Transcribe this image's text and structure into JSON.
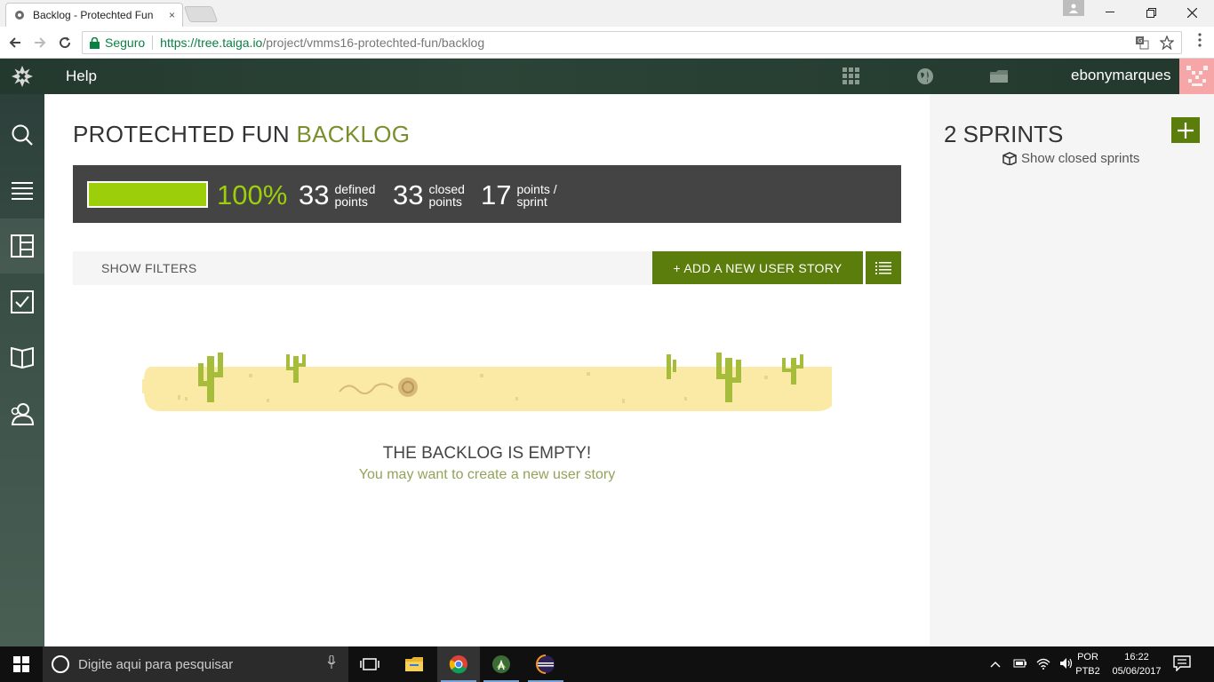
{
  "browser": {
    "tab_title": "Backlog - Protechted Fun",
    "tab_close": "×",
    "secure_label": "Seguro",
    "url_host": "https://tree.taiga.io",
    "url_path": "/project/vmms16-protechted-fun/backlog"
  },
  "topnav": {
    "help": "Help",
    "username": "ebonymarques",
    "icons": [
      "apps-grid-icon",
      "globe-icon",
      "folder-icon"
    ]
  },
  "sidebar": {
    "items": [
      "search-icon",
      "backlog-icon",
      "kanban-icon",
      "issues-icon",
      "wiki-icon",
      "team-icon"
    ]
  },
  "backlog": {
    "title_project": "PROTECHTED FUN",
    "title_section": "BACKLOG",
    "progress_percent": 100,
    "percent_label": "100%",
    "defined_points": "33",
    "defined_label_1": "defined",
    "defined_label_2": "points",
    "closed_points": "33",
    "closed_label_1": "closed",
    "closed_label_2": "points",
    "sprint_points": "17",
    "sprint_label_1": "points /",
    "sprint_label_2": "sprint",
    "show_filters": "SHOW FILTERS",
    "add_story": "+ ADD A NEW USER STORY",
    "empty_title": "THE BACKLOG IS EMPTY!",
    "empty_sub": "You may want to create a new user story"
  },
  "sprints": {
    "title": "2 SPRINTS",
    "show_closed": "Show closed sprints"
  },
  "taskbar": {
    "search_placeholder": "Digite aqui para pesquisar",
    "lang_1": "POR",
    "lang_2": "PTB2",
    "time": "16:22",
    "date": "05/06/2017"
  },
  "colors": {
    "accent_green": "#5b7d0b",
    "progress_green": "#9dce0a",
    "nav_dark": "#23382d"
  }
}
